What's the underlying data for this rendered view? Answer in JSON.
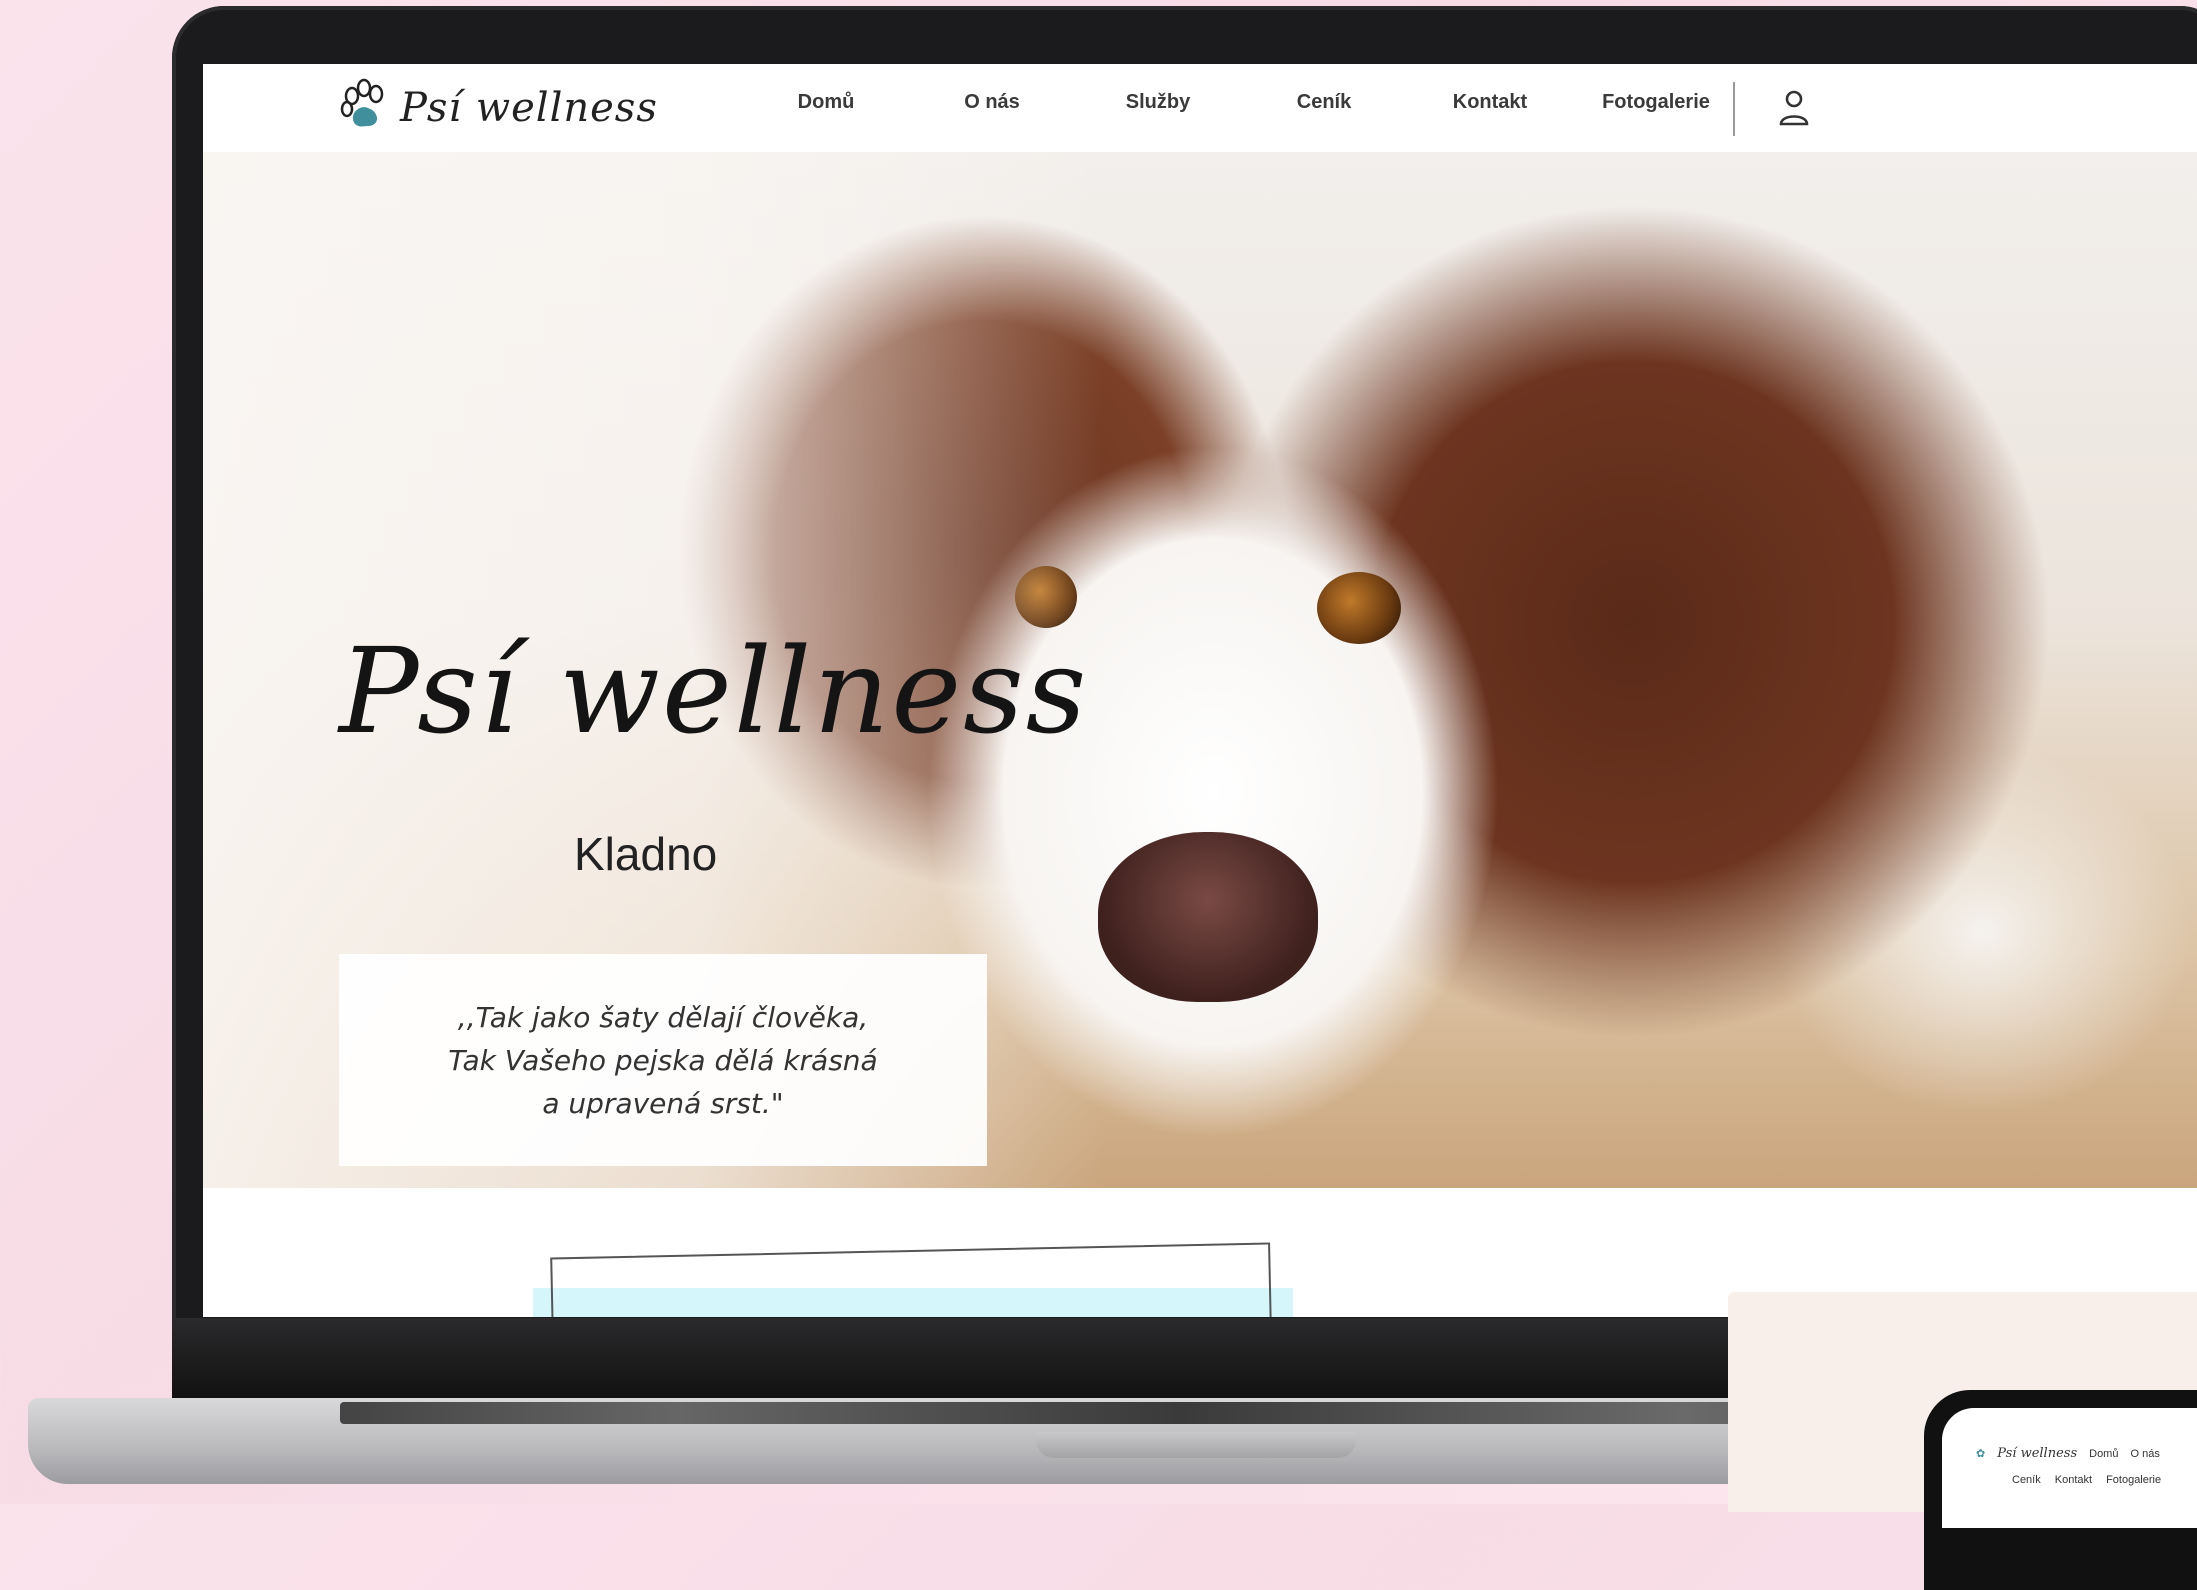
{
  "nav": {
    "logo_text": "Psí wellness",
    "links": [
      "Domů",
      "O nás",
      "Služby",
      "Ceník",
      "Kontakt",
      "Fotogalerie"
    ]
  },
  "hero": {
    "title": "Psí wellness",
    "subtitle": "Kladno",
    "quote": ",,Tak jako šaty dělají člověka,\nTak Vašeho pejska dělá krásná\na upravená srst.\""
  },
  "phone": {
    "logo_text": "Psí wellness",
    "row1_links": [
      "Domů",
      "O nás"
    ],
    "row2_links": [
      "Ceník",
      "Kontakt",
      "Fotogalerie"
    ]
  },
  "colors": {
    "logo_paw": "#3f8f9c",
    "cyan_block": "#d5f6fb",
    "background": "#fbe3ec"
  }
}
